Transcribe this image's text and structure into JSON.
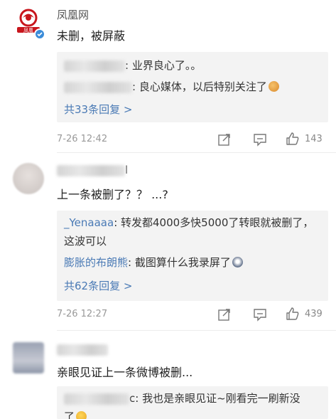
{
  "comments": [
    {
      "username": "凤凰网",
      "avatar_icon": "phoenix-logo-avatar",
      "badge_icon": "verified-badge-icon",
      "text": "未删，被屏蔽",
      "replies": [
        {
          "text": ": 业界良心了。。"
        },
        {
          "text": ": 良心媒体，以后特别关注了",
          "emoji": "clapping-emoji"
        }
      ],
      "more_replies": "共33条回复 >",
      "time": "7-26 12:42",
      "likes": "143"
    },
    {
      "username_suffix": "l",
      "text": "上一条被删了？？ ...?",
      "replies": [
        {
          "name": "_Yenaaaa",
          "text": ": 转发都4000多快5000了转眼就被删了，这波可以"
        },
        {
          "name": "膨胀的布朗熊",
          "text": ": 截图算什么我录屏了",
          "emoji": "scared-emoji"
        }
      ],
      "more_replies": "共62条回复 >",
      "time": "7-26 12:27",
      "likes": "439"
    },
    {
      "text": "亲眼见证上一条微博被删...",
      "replies": [
        {
          "text": "c: 我也是亲眼见证~刚看完一刷新没了",
          "emoji": "laughing-emoji"
        }
      ]
    }
  ],
  "colors": {
    "link": "#4a7ab5",
    "reply_bg": "#f3f3f3",
    "meta": "#999999",
    "avatar_red": "#c8161d"
  }
}
